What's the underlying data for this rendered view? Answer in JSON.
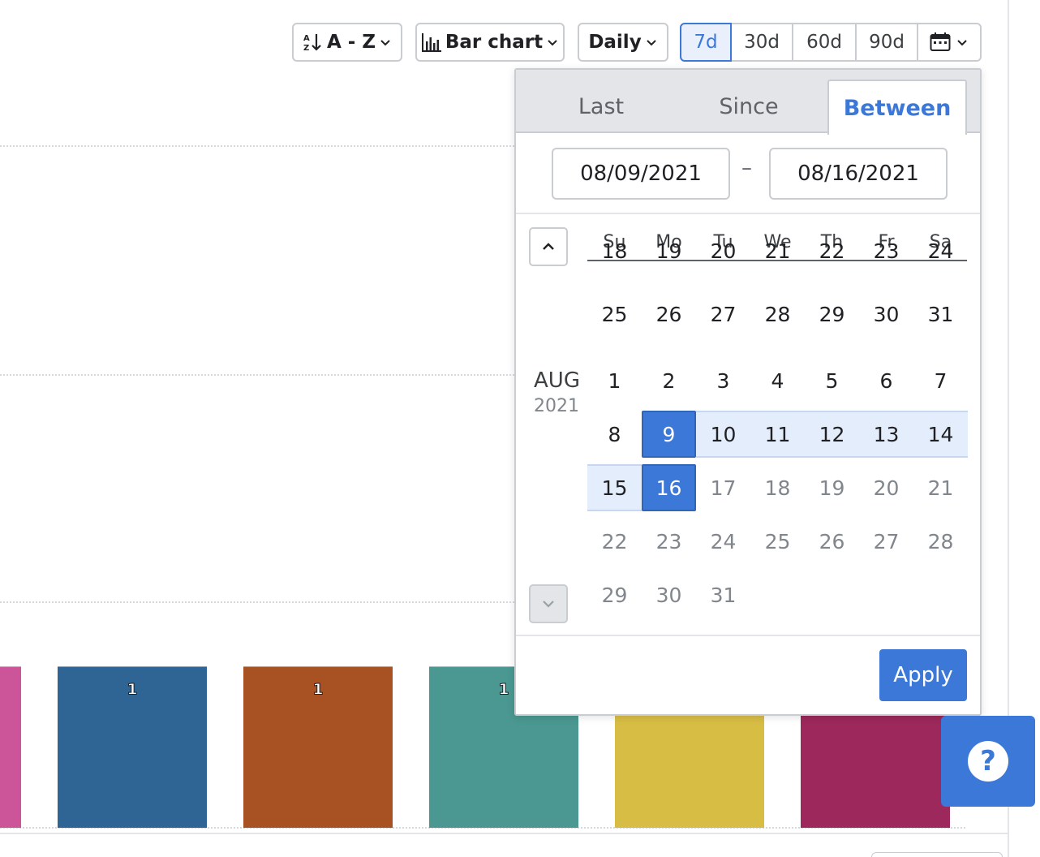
{
  "toolbar": {
    "sort_label": "A - Z",
    "chart_type_label": "Bar chart",
    "interval_label": "Daily",
    "ranges": [
      "7d",
      "30d",
      "60d",
      "90d"
    ],
    "active_range": "7d"
  },
  "date_picker": {
    "tabs": [
      "Last",
      "Since",
      "Between"
    ],
    "active_tab": "Between",
    "start_date": "08/09/2021",
    "end_date": "08/16/2021",
    "range_separator": "–",
    "weekdays": [
      "Su",
      "Mo",
      "Tu",
      "We",
      "Th",
      "Fr",
      "Sa"
    ],
    "month_label": "AUG",
    "year_label": "2021",
    "partial_week": [
      "18",
      "19",
      "20",
      "21",
      "22",
      "23",
      "24"
    ],
    "weeks": [
      [
        "25",
        "26",
        "27",
        "28",
        "29",
        "30",
        "31"
      ],
      [
        "1",
        "2",
        "3",
        "4",
        "5",
        "6",
        "7"
      ],
      [
        "8",
        "9",
        "10",
        "11",
        "12",
        "13",
        "14"
      ],
      [
        "15",
        "16",
        "17",
        "18",
        "19",
        "20",
        "21"
      ],
      [
        "22",
        "23",
        "24",
        "25",
        "26",
        "27",
        "28"
      ],
      [
        "29",
        "30",
        "31"
      ]
    ],
    "apply_label": "Apply"
  },
  "help_label": "?",
  "chart_data": {
    "type": "bar",
    "categories": [
      "",
      "",
      "",
      "",
      "",
      ""
    ],
    "values": [
      1,
      1,
      1,
      1,
      1,
      1
    ],
    "data_labels": [
      "",
      "1",
      "1",
      "1",
      "",
      ""
    ],
    "colors": [
      "#cc5599",
      "#2e6595",
      "#a85224",
      "#4a9891",
      "#d8bd45",
      "#9c285c"
    ],
    "grid": true
  }
}
